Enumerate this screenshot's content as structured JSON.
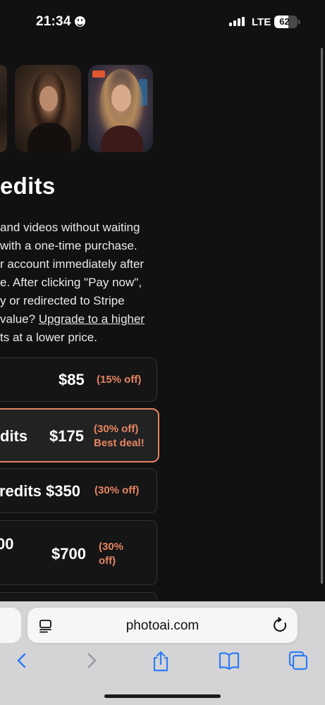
{
  "status_bar": {
    "time": "21:34",
    "network": "LTE",
    "battery_level": "62",
    "battery_fraction": 0.62
  },
  "page": {
    "heading": "edits",
    "description_lines": [
      "and videos without waiting",
      " with a one-time purchase.",
      "r account immediately after",
      "e. After clicking \"Pay now\",",
      "y or redirected to Stripe"
    ],
    "description_line6_prefix": " value? ",
    "upgrade_link": "Upgrade to a higher",
    "description_line7": "ts at a lower price.",
    "plans": [
      {
        "label": "",
        "price": "$85",
        "discount": "(15% off)",
        "badge": ""
      },
      {
        "label": "dits",
        "price": "$175",
        "discount": "(30% off)",
        "badge": "Best deal!"
      },
      {
        "label": "redits",
        "price": "$350",
        "discount": "(30% off)",
        "badge": ""
      },
      {
        "label": "00",
        "price": "$700",
        "discount_line1": "(30%",
        "discount_line2": "off)",
        "badge": ""
      }
    ]
  },
  "browser": {
    "url": "photoai.com"
  },
  "colors": {
    "background": "#111111",
    "accent": "#e58462",
    "browser_bar": "#d4d4d6",
    "toolbar_icon": "#2f7cf6"
  }
}
